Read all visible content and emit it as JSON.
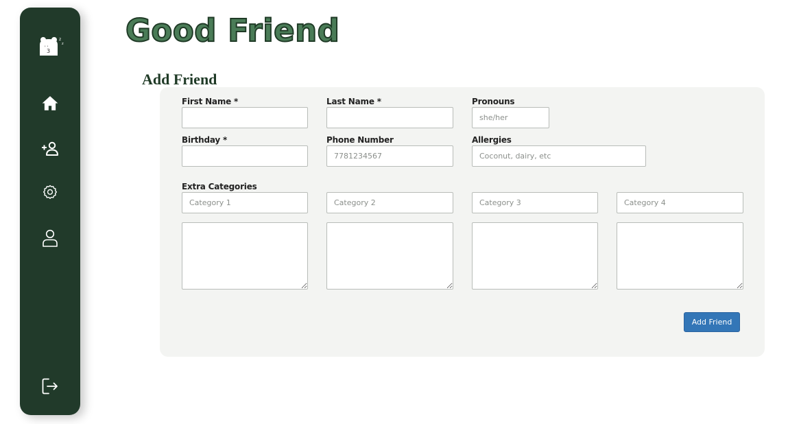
{
  "app": {
    "title": "Good Friend",
    "logo": "bear-face-icon"
  },
  "sidebar": {
    "items": [
      {
        "icon": "home-icon"
      },
      {
        "icon": "add-person-icon"
      },
      {
        "icon": "gear-icon"
      },
      {
        "icon": "user-icon"
      }
    ],
    "footer": {
      "icon": "logout-icon"
    }
  },
  "page": {
    "heading": "Add Friend"
  },
  "form": {
    "first_name": {
      "label": "First Name *",
      "value": "",
      "placeholder": ""
    },
    "last_name": {
      "label": "Last Name *",
      "value": "",
      "placeholder": ""
    },
    "pronouns": {
      "label": "Pronouns",
      "value": "",
      "placeholder": "she/her"
    },
    "birthday": {
      "label": "Birthday *",
      "value": "",
      "placeholder": ""
    },
    "phone": {
      "label": "Phone Number",
      "value": "",
      "placeholder": "7781234567"
    },
    "allergies": {
      "label": "Allergies",
      "value": "",
      "placeholder": "Coconut, dairy, etc"
    },
    "extra": {
      "label": "Extra Categories",
      "categories": [
        {
          "placeholder": "Category 1",
          "value": "",
          "notes": ""
        },
        {
          "placeholder": "Category 2",
          "value": "",
          "notes": ""
        },
        {
          "placeholder": "Category 3",
          "value": "",
          "notes": ""
        },
        {
          "placeholder": "Category 4",
          "value": "",
          "notes": ""
        }
      ]
    },
    "submit_label": "Add Friend"
  },
  "colors": {
    "sidebar": "#213a2a",
    "title_fill": "#4a7c57",
    "card_bg": "#f3f4f2",
    "button": "#3376b7"
  }
}
